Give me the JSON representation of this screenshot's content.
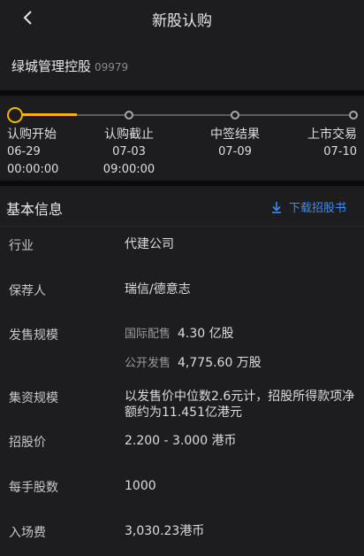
{
  "header": {
    "title": "新股认购"
  },
  "stock": {
    "name": "绿城管理控股",
    "code": "09979"
  },
  "timeline": {
    "steps": [
      {
        "label": "认购开始",
        "date": "06-29",
        "time": "00:00:00"
      },
      {
        "label": "认购截止",
        "date": "07-03",
        "time": "09:00:00"
      },
      {
        "label": "中签结果",
        "date": "07-09"
      },
      {
        "label": "上市交易",
        "date": "07-10"
      }
    ],
    "accent_color": "#f5b400"
  },
  "info": {
    "title": "基本信息",
    "download_label": "下载招股书",
    "rows": {
      "industry": {
        "label": "行业",
        "value": "代建公司"
      },
      "sponsor": {
        "label": "保荐人",
        "value": "瑞信/德意志"
      },
      "issue": {
        "label": "发售规模",
        "intl_label": "国际配售",
        "intl_value": "4.30 亿股",
        "public_label": "公开发售",
        "public_value": "4,775.60 万股"
      },
      "fundraise": {
        "label": "集资规模",
        "value_line1": "以发售价中位数2.6元计，招股所得款项净",
        "value_line2": "额约为11.451亿港元"
      },
      "price": {
        "label": "招股价",
        "value": "2.200 - 3.000 港币"
      },
      "lot": {
        "label": "每手股数",
        "value": "1000"
      },
      "entry_fee": {
        "label": "入场费",
        "value": "3,030.23港币"
      }
    }
  }
}
